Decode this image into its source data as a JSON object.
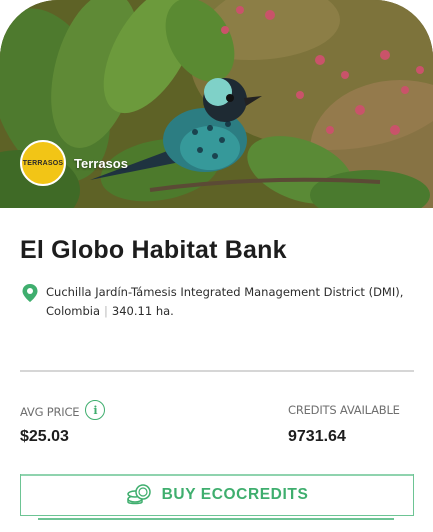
{
  "hero": {
    "brand_logo_text": "TERRASOS",
    "brand_name": "Terrasos"
  },
  "title": "El Globo Habitat Bank",
  "location": {
    "icon": "location-pin-icon",
    "place": "Cuchilla Jardín-Támesis Integrated Management District (DMI), Colombia",
    "separator": "|",
    "area": "340.11 ha."
  },
  "stats": {
    "avg_price_label": "AVG PRICE",
    "avg_price_value": "$25.03",
    "info_icon_glyph": "i",
    "credits_label": "CREDITS AVAILABLE",
    "credits_value": "9731.64"
  },
  "buy_button": {
    "icon": "coins-icon",
    "label": "BUY ECOCREDITS"
  },
  "colors": {
    "accent": "#3fae6e",
    "brand_yellow": "#f2c516",
    "text": "#1d1d1d"
  }
}
